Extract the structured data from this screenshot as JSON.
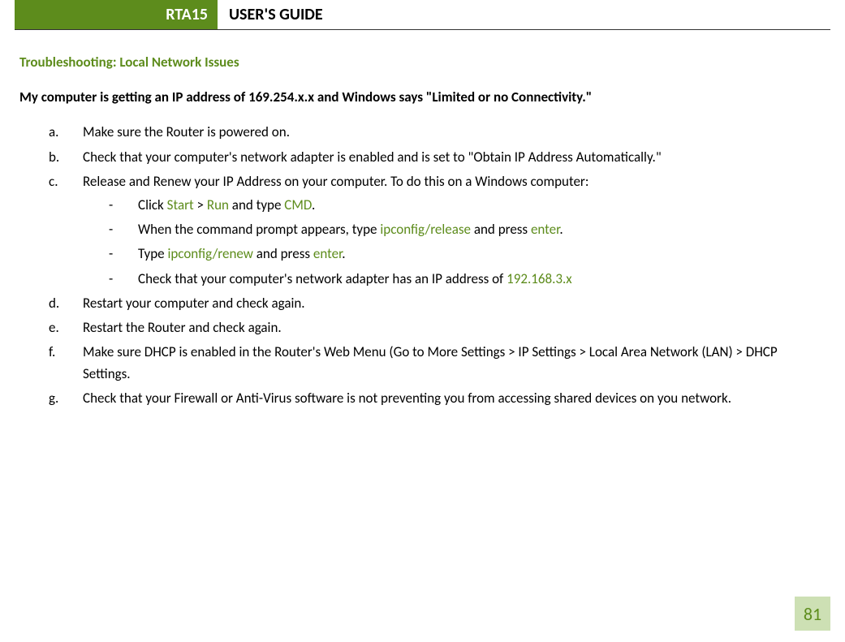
{
  "header": {
    "prefix": "RTA15",
    "title": "USER'S GUIDE"
  },
  "section_heading": "Troubleshooting: Local Network Issues",
  "sub_heading": "My computer is getting an IP address of 169.254.x.x and Windows says \"Limited or no Connectivity.\"",
  "list": {
    "a": {
      "marker": "a.",
      "text": "Make sure the Router is powered on."
    },
    "b": {
      "marker": "b.",
      "text": "Check that your computer's network adapter is enabled and is set to \"Obtain IP Address Automatically.\""
    },
    "c": {
      "marker": "c.",
      "text": "Release and Renew your IP Address on your computer.  To do this on a Windows computer:",
      "sub": {
        "s1": {
          "marker": "-",
          "p1": "Click ",
          "start": "Start",
          "p2": " > ",
          "run": "Run",
          "p3": " and type ",
          "cmd": "CMD",
          "p4": "."
        },
        "s2": {
          "marker": "-",
          "p1": "When the command prompt appears, type ",
          "ip_release": "ipconfig/release",
          "p2": " and press ",
          "enter1": "enter",
          "p3": "."
        },
        "s3": {
          "marker": "-",
          "p1": "Type ",
          "ip_renew": "ipconfig/renew",
          "p2": " and press ",
          "enter2": "enter",
          "p3": "."
        },
        "s4": {
          "marker": "-",
          "p1": "Check that your computer's network adapter has an IP address of ",
          "ip": "192.168.3.x"
        }
      }
    },
    "d": {
      "marker": "d.",
      "text": "Restart your computer and check again."
    },
    "e": {
      "marker": "e.",
      "text": "Restart the Router and check again."
    },
    "f": {
      "marker": "f.",
      "text": "Make sure DHCP is enabled in the Router's Web Menu (Go to More Settings > IP Settings > Local Area Network (LAN) > DHCP Settings."
    },
    "g": {
      "marker": "g.",
      "text": "Check that your Firewall or Anti-Virus software is not preventing you from accessing shared devices on you network."
    }
  },
  "page_number": "81"
}
